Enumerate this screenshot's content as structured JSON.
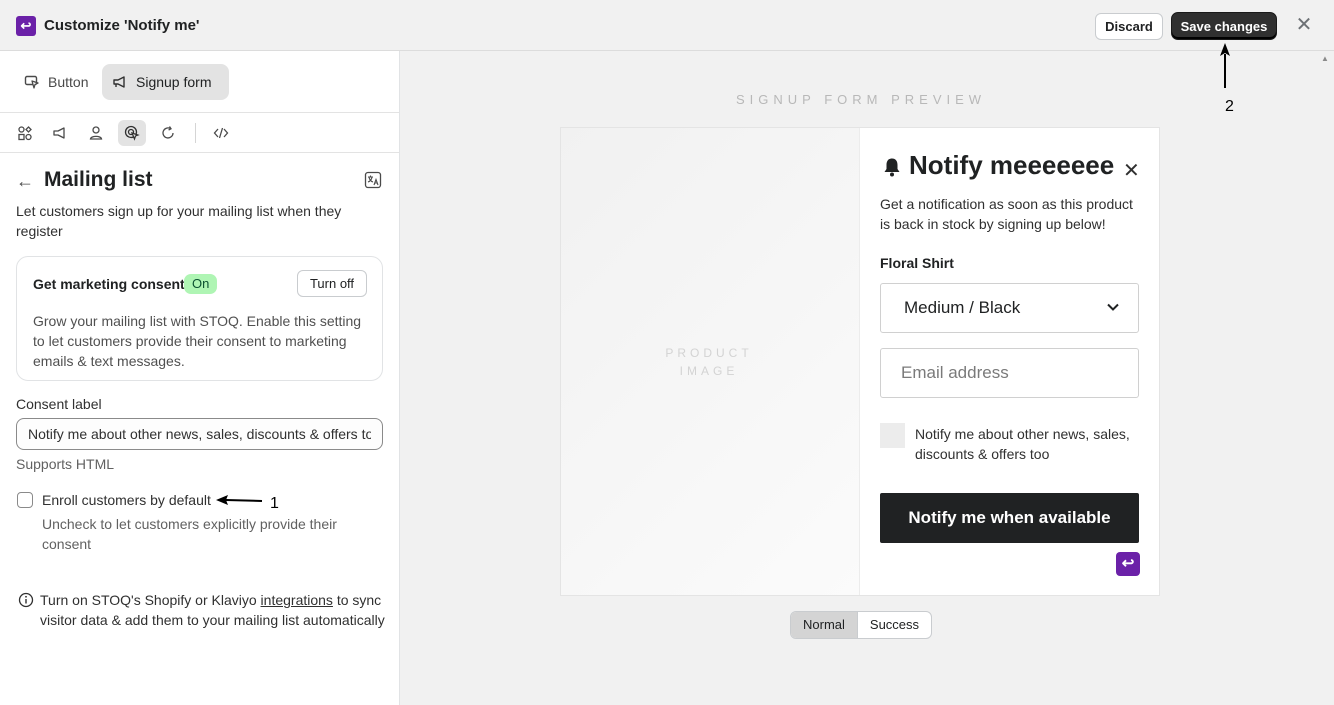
{
  "header": {
    "title": "Customize 'Notify me'",
    "discard_label": "Discard",
    "save_label": "Save changes"
  },
  "left": {
    "tabs": [
      {
        "label": "Button",
        "icon": "cursor-click-icon"
      },
      {
        "label": "Signup form",
        "icon": "megaphone-icon"
      }
    ],
    "section_title": "Mailing list",
    "description": "Let customers sign up for your mailing list when they register",
    "consent_card": {
      "title": "Get marketing consent",
      "badge": "On",
      "button": "Turn off",
      "body": "Grow your mailing list with STOQ. Enable this setting to let customers provide their consent to marketing emails & text messages."
    },
    "consent_label": {
      "label": "Consent label",
      "value": "Notify me about other news, sales, discounts & offers too",
      "help": "Supports HTML"
    },
    "enroll": {
      "label": "Enroll customers by default",
      "help": "Uncheck to let customers explicitly provide their consent",
      "checked": false
    },
    "info": {
      "text_before": "Turn on STOQ's Shopify or Klaviyo ",
      "link": "integrations",
      "text_after": " to sync visitor data & add them to your mailing list automatically"
    }
  },
  "canvas": {
    "preview_title": "SIGNUP FORM PREVIEW",
    "product_image_line1": "PRODUCT",
    "product_image_line2": "IMAGE",
    "form": {
      "title": "Notify meeeeeee",
      "description": "Get a notification as soon as this product is back in stock by signing up below!",
      "product_name": "Floral Shirt",
      "variant": "Medium / Black",
      "email_placeholder": "Email address",
      "consent_text": "Notify me about other news, sales, discounts & offers too",
      "submit_label": "Notify me when available"
    },
    "states": [
      "Normal",
      "Success"
    ],
    "active_state": "Normal"
  },
  "annotations": {
    "label_1": "1",
    "label_2": "2"
  },
  "colors": {
    "brand": "#6b21a8",
    "primary_button": "#202223",
    "badge_on_bg": "#aff5b4"
  }
}
